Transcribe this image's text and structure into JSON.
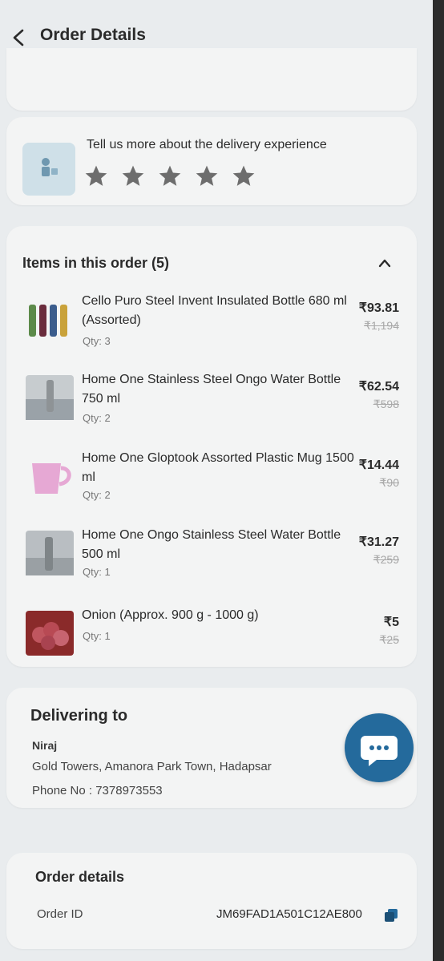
{
  "header": {
    "title": "Order Details"
  },
  "rating": {
    "prompt": "Tell us more about the delivery experience",
    "stars_total": 5
  },
  "items_section": {
    "heading": "Items in this order (5)",
    "items": [
      {
        "name": "Cello Puro Steel Invent Insulated Bottle 680 ml (Assorted)",
        "qty": "Qty: 3",
        "price": "₹93.81",
        "mrp": "₹1,194"
      },
      {
        "name": "Home One Stainless Steel Ongo Water Bottle 750 ml",
        "qty": "Qty: 2",
        "price": "₹62.54",
        "mrp": "₹598"
      },
      {
        "name": "Home One Gloptook Assorted Plastic Mug 1500 ml",
        "qty": "Qty: 2",
        "price": "₹14.44",
        "mrp": "₹90"
      },
      {
        "name": "Home One Ongo Stainless Steel Water Bottle 500 ml",
        "qty": "Qty: 1",
        "price": "₹31.27",
        "mrp": "₹259"
      },
      {
        "name": "Onion (Approx. 900 g - 1000 g)",
        "qty": "Qty: 1",
        "price": "₹5",
        "mrp": "₹25"
      }
    ]
  },
  "delivery": {
    "heading": "Delivering to",
    "name": "Niraj",
    "address": "Gold Towers, Amanora Park Town, Hadapsar",
    "phone": "Phone No : 7378973553"
  },
  "order_details": {
    "heading": "Order details",
    "id_label": "Order ID",
    "id_value": "JM69FAD1A501C12AE800"
  },
  "colors": {
    "accent": "#246a9c",
    "card": "#f3f4f4",
    "background": "#e9ecee"
  }
}
